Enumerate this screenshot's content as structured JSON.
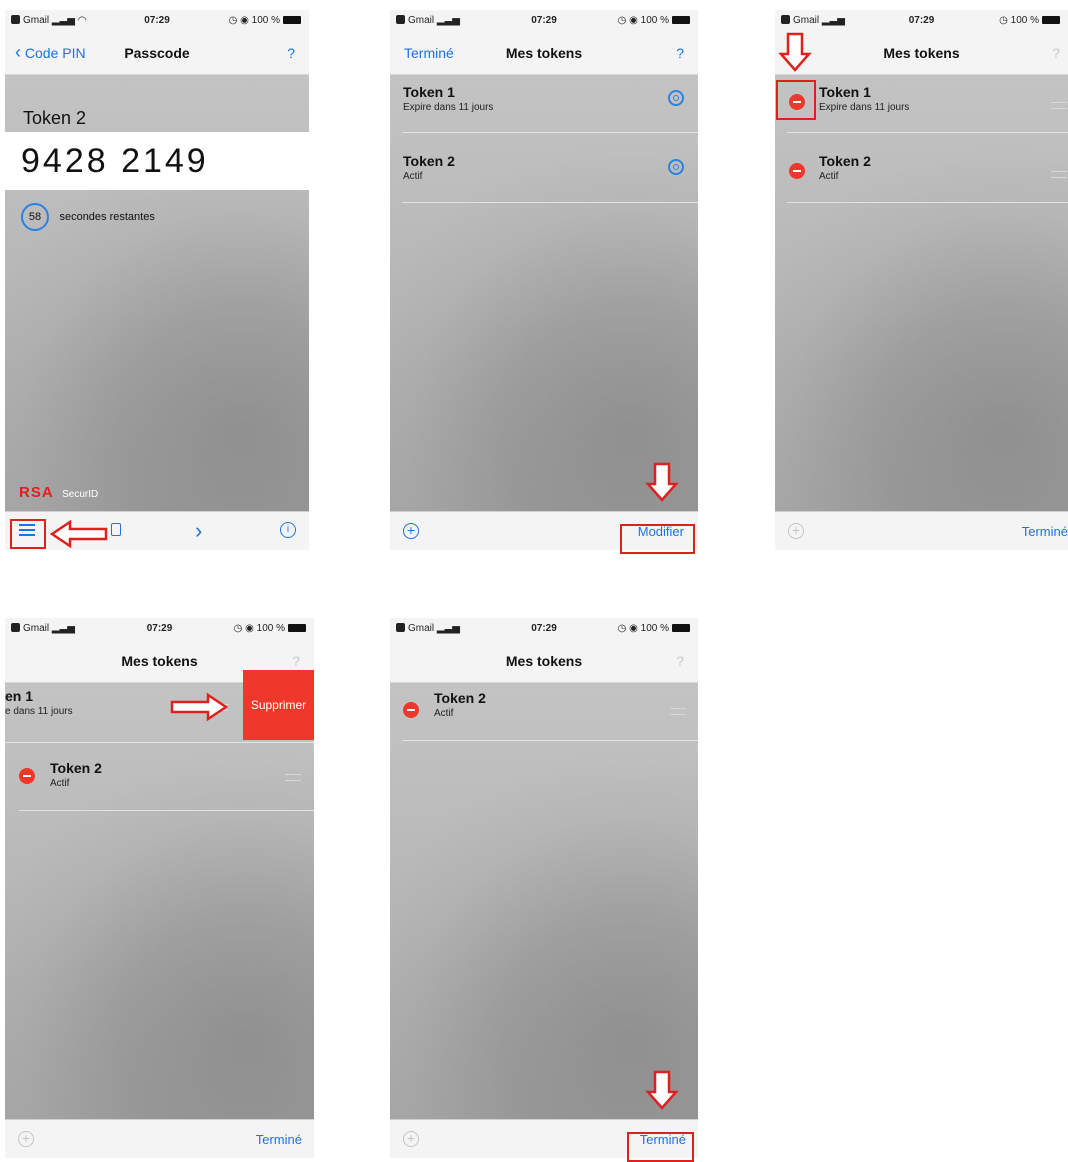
{
  "status": {
    "carrier": "Gmail",
    "time": "07:29",
    "battery": "100 %"
  },
  "screen1": {
    "back_label": "Code PIN",
    "title": "Passcode",
    "help": "?",
    "token_name": "Token 2",
    "code": "9428 2149",
    "countdown": "58",
    "countdown_text": "secondes restantes",
    "brand_rsa": "RSA",
    "brand_securid": "SecurID",
    "tab_forward": "›",
    "tab_info": "i"
  },
  "screen2": {
    "left": "Terminé",
    "title": "Mes tokens",
    "help": "?",
    "tokens": [
      {
        "name": "Token 1",
        "sub": "Expire dans 11 jours"
      },
      {
        "name": "Token 2",
        "sub": "Actif"
      }
    ],
    "edit": "Modifier"
  },
  "screen3": {
    "title": "Mes tokens",
    "help": "?",
    "tokens": [
      {
        "name": "Token 1",
        "sub": "Expire dans 11 jours"
      },
      {
        "name": "Token 2",
        "sub": "Actif"
      }
    ],
    "done": "Terminé"
  },
  "screen4": {
    "title": "Mes tokens",
    "help": "?",
    "token1_name": "en 1",
    "token1_sub": "e dans 11 jours",
    "delete_label": "Supprimer",
    "token2_name": "Token 2",
    "token2_sub": "Actif",
    "done": "Terminé"
  },
  "screen5": {
    "title": "Mes tokens",
    "help": "?",
    "token_name": "Token 2",
    "token_sub": "Actif",
    "done": "Terminé"
  },
  "colors": {
    "accent": "#1a73e8",
    "delete": "#f0372b",
    "highlight": "#e0201e",
    "rsa_red": "#e0201e"
  }
}
